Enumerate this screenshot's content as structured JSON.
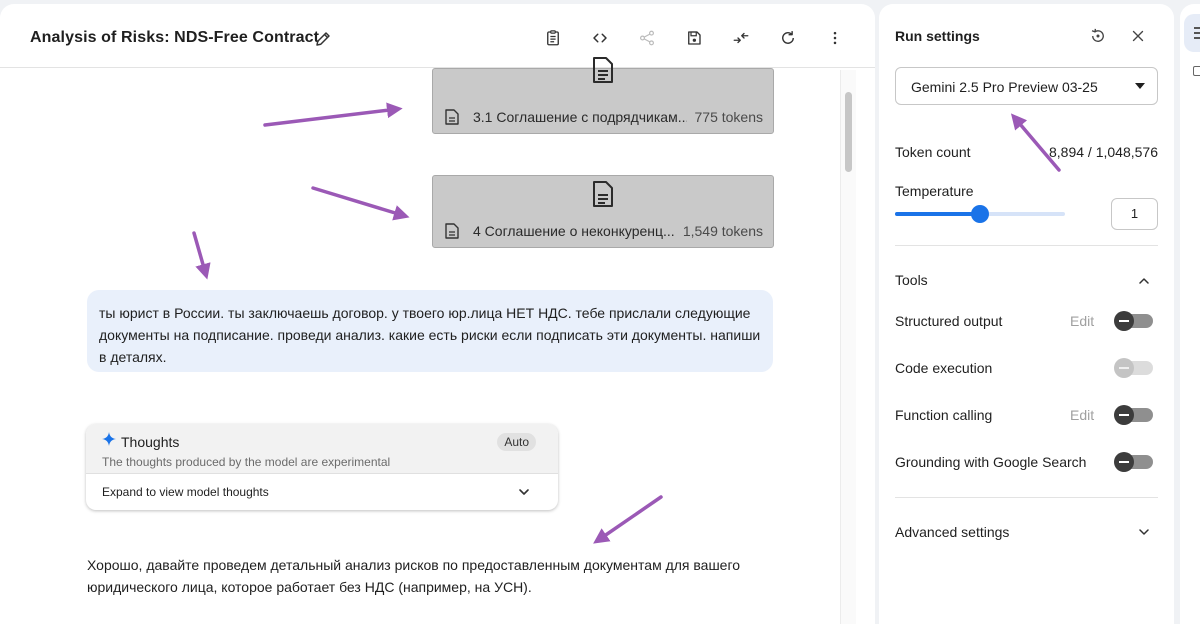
{
  "header": {
    "title": "Analysis of Risks: NDS-Free Contract"
  },
  "attachments": [
    {
      "name": "3.1 Соглашение с подрядчикам...",
      "tokens": "775 tokens"
    },
    {
      "name": "4 Соглашение о неконкуренц...",
      "tokens": "1,549 tokens"
    }
  ],
  "user_message": {
    "lines": [
      "ты юрист в России. ты заключаешь договор. у твоего юр.лица НЕТ НДС. тебе прислали следующие",
      "документы на подписание. проведи анализ. какие есть риски если подписать эти документы. напиши",
      "в деталях."
    ]
  },
  "thoughts": {
    "title": "Thoughts",
    "badge": "Auto",
    "subtitle": "The thoughts produced by the model are experimental",
    "expand_label": "Expand to view model thoughts"
  },
  "answer": {
    "lines": [
      "Хорошо, давайте проведем детальный анализ рисков по предоставленным документам для вашего",
      "юридического лица, которое работает без НДС (например, на УСН)."
    ]
  },
  "run_settings": {
    "title": "Run settings",
    "model": "Gemini 2.5 Pro Preview 03-25",
    "token_count_label": "Token count",
    "token_count_value": "8,894 / 1,048,576",
    "temperature_label": "Temperature",
    "temperature_value": "1",
    "temperature_fraction": 0.5,
    "tools_label": "Tools",
    "tools": [
      {
        "label": "Structured output",
        "edit": "Edit",
        "enabled": false,
        "disabled": false
      },
      {
        "label": "Code execution",
        "edit": "",
        "enabled": false,
        "disabled": true
      },
      {
        "label": "Function calling",
        "edit": "Edit",
        "enabled": false,
        "disabled": false
      },
      {
        "label": "Grounding with Google Search",
        "edit": "",
        "enabled": false,
        "disabled": false
      }
    ],
    "advanced_label": "Advanced settings"
  },
  "colors": {
    "accent": "#1a73e8",
    "annotation_arrow": "#9b59b6",
    "user_bubble": "#e9f0fb",
    "attachment_bg": "#c9c9c9"
  },
  "icons": {
    "header": [
      "edit-pencil-icon",
      "clipboard-icon",
      "code-icon",
      "share-icon",
      "save-icon",
      "compare-icon",
      "refresh-icon",
      "more-vert-icon"
    ],
    "settings": [
      "reset-settings-icon",
      "close-icon"
    ]
  }
}
